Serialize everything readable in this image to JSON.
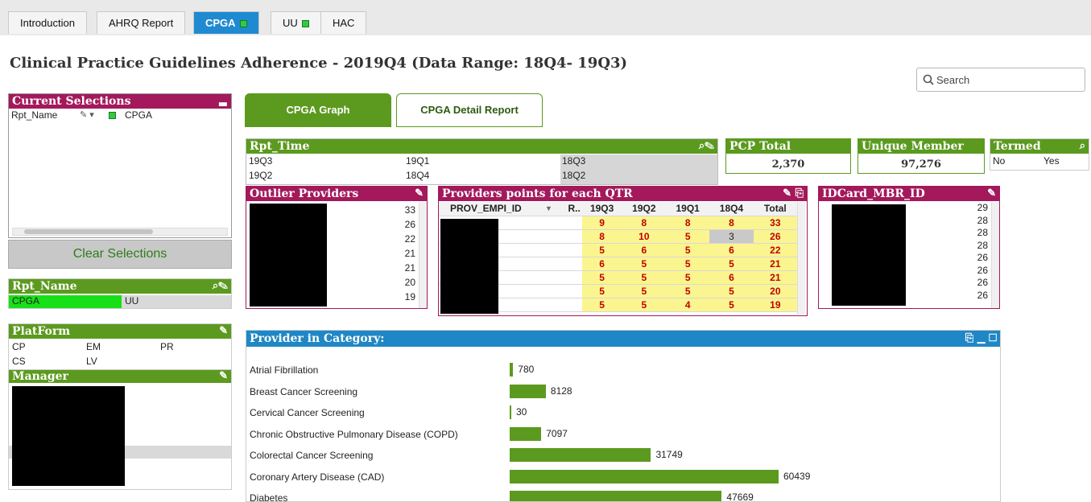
{
  "tabs": [
    {
      "label": "Introduction",
      "active": false,
      "indicator": false
    },
    {
      "label": "AHRQ Report",
      "active": false,
      "indicator": false
    },
    {
      "label": "CPGA",
      "active": true,
      "indicator": true
    },
    {
      "label": "UU",
      "active": false,
      "indicator": true
    },
    {
      "label": "HAC",
      "active": false,
      "indicator": false
    }
  ],
  "page_title": "Clinical Practice Guidelines Adherence - 2019Q4 (Data Range: 18Q4- 19Q3)",
  "search": {
    "placeholder": "Search"
  },
  "current_selections": {
    "title": "Current Selections",
    "field": "Rpt_Name",
    "value": "CPGA"
  },
  "clear_selections_label": "Clear Selections",
  "rpt_name": {
    "title": "Rpt_Name",
    "items": [
      "CPGA",
      "UU"
    ],
    "selected": "CPGA"
  },
  "platform": {
    "title": "PlatForm",
    "items": [
      "CP",
      "EM",
      "PR",
      "CS",
      "LV"
    ]
  },
  "manager": {
    "title": "Manager"
  },
  "buttons": {
    "graph": "CPGA Graph",
    "detail": "CPGA Detail Report"
  },
  "rpt_time": {
    "title": "Rpt_Time",
    "items": [
      "19Q3",
      "19Q1",
      "18Q3",
      "19Q2",
      "18Q4",
      "18Q2"
    ]
  },
  "pcp_total": {
    "title": "PCP Total",
    "value": "2,370"
  },
  "unique_member": {
    "title": "Unique Member",
    "value": "97,276"
  },
  "termed": {
    "title": "Termed",
    "items": [
      "No",
      "Yes"
    ]
  },
  "outlier_providers": {
    "title": "Outlier Providers",
    "values": [
      "33",
      "26",
      "22",
      "21",
      "21",
      "20",
      "19"
    ]
  },
  "providers_points": {
    "title": "Providers points for each QTR",
    "columns": [
      "PROV_EMPI_ID",
      "R..",
      "19Q3",
      "19Q2",
      "19Q1",
      "18Q4",
      "Total"
    ],
    "rows": [
      [
        "9",
        "8",
        "8",
        "8",
        "33"
      ],
      [
        "8",
        "10",
        "5",
        "3",
        "26"
      ],
      [
        "5",
        "6",
        "5",
        "6",
        "22"
      ],
      [
        "6",
        "5",
        "5",
        "5",
        "21"
      ],
      [
        "5",
        "5",
        "5",
        "6",
        "21"
      ],
      [
        "5",
        "5",
        "5",
        "5",
        "20"
      ],
      [
        "5",
        "5",
        "4",
        "5",
        "19"
      ]
    ]
  },
  "idcard": {
    "title": "IDCard_MBR_ID",
    "values": [
      "29",
      "28",
      "28",
      "28",
      "26",
      "26",
      "26",
      "26"
    ]
  },
  "provider_category": {
    "title": "Provider in Category:"
  },
  "chart_data": {
    "type": "bar",
    "orientation": "horizontal",
    "title": "Provider in Category:",
    "categories": [
      "Atrial Fibrillation",
      "Breast Cancer Screening",
      "Cervical Cancer Screening",
      "Chronic Obstructive Pulmonary Disease (COPD)",
      "Colorectal Cancer Screening",
      "Coronary Artery Disease (CAD)",
      "Diabetes"
    ],
    "values": [
      780,
      8128,
      30,
      7097,
      31749,
      60439,
      47669
    ],
    "color": "#5b9a1e"
  },
  "colors": {
    "green": "#5b9a1e",
    "magenta": "#a3195b",
    "blue": "#1f87c5",
    "tab_active": "#1f8ad0",
    "highlight_yellow": "#fbf58f",
    "value_red": "#c00000"
  }
}
